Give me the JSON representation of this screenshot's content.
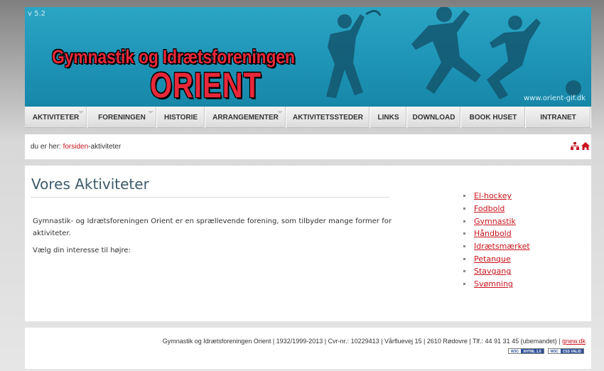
{
  "header": {
    "version": "v 5.2",
    "logo_line1": "Gymnastik og Idrætsforeningen",
    "logo_line2": "ORIENT",
    "site_url": "www.orient-gif.dk"
  },
  "nav": {
    "items": [
      {
        "label": "AKTIVITETER",
        "dropdown": true
      },
      {
        "label": "FORENINGEN",
        "dropdown": true
      },
      {
        "label": "HISTORIE",
        "dropdown": false
      },
      {
        "label": "ARRANGEMENTER",
        "dropdown": true
      },
      {
        "label": "AKTIVITETSSTEDER",
        "dropdown": false
      },
      {
        "label": "LINKS",
        "dropdown": false
      },
      {
        "label": "DOWNLOAD",
        "dropdown": false
      },
      {
        "label": "BOOK HUSET",
        "dropdown": false
      },
      {
        "label": "INTRANET",
        "dropdown": false
      }
    ]
  },
  "breadcrumb": {
    "prefix": "du er her:",
    "home_link": "forsiden",
    "separator": " - ",
    "current": "aktiviteter",
    "icons": [
      "sitemap-icon",
      "home-icon"
    ]
  },
  "main": {
    "title": "Vores Aktiviteter",
    "paragraph1": "Gymnastik- og Idrætsforeningen Orient er en sprællevende forening, som tilbyder mange former for aktiviteter.",
    "paragraph2": "Vælg din interesse til højre:"
  },
  "activities": [
    "El-hockey",
    "Fodbold",
    "Gymnastik",
    "Håndbold",
    "Idrætsmærket",
    "Petanque",
    "Stavgang",
    "Svømning"
  ],
  "footer": {
    "text": "Gymnastik og Idrætsforeningen Orient | 1932/1999-2013 | Cvr-nr.: 10229413 | Vårfluevej 15 | 2610 Rødovre | Tlf.: 44 91 31 45 (ubemandet) |",
    "credit_link": "gnew.dk",
    "badges": [
      {
        "w3": "W3C",
        "text": "XHTML 1.0"
      },
      {
        "w3": "W3C",
        "text": "CSS VALID"
      }
    ]
  },
  "colors": {
    "header_bg": "#1e94b6",
    "logo_red": "#e8283a",
    "link_red": "#c8141e",
    "title_color": "#3c5a6a"
  }
}
